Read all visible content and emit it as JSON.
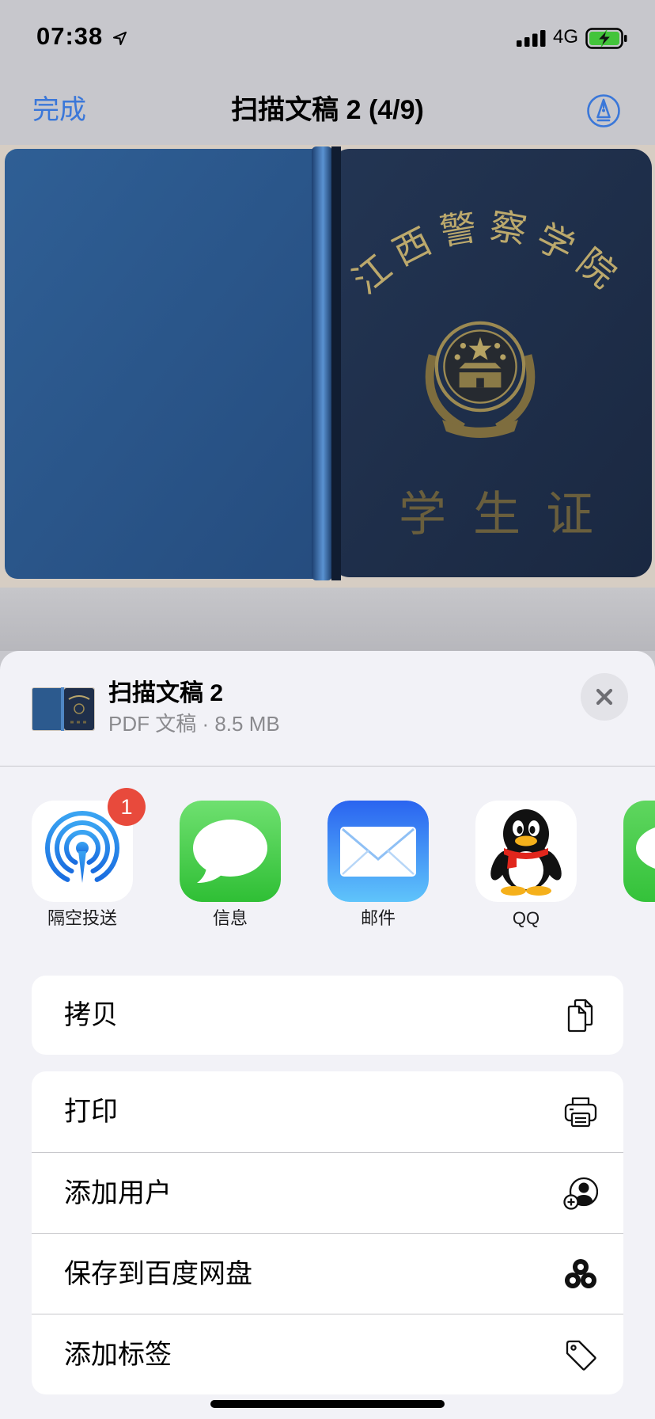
{
  "status_bar": {
    "time": "07:38",
    "network": "4G",
    "icons": [
      "location-arrow-icon",
      "cellular-signal-icon",
      "battery-charging-icon"
    ]
  },
  "nav": {
    "done_label": "完成",
    "title": "扫描文稿 2 (4/9)",
    "markup_icon": "markup-pen-icon"
  },
  "document_photo": {
    "school_name": "江西警察学院",
    "card_title": "学生证",
    "emblem": "national-emblem-icon"
  },
  "share_sheet": {
    "file_name": "扫描文稿 2",
    "file_meta": "PDF 文稿 · 8.5 MB",
    "close_icon": "close-icon",
    "apps": [
      {
        "label": "隔空投送",
        "icon": "airdrop-icon",
        "badge": "1"
      },
      {
        "label": "信息",
        "icon": "messages-icon"
      },
      {
        "label": "邮件",
        "icon": "mail-icon"
      },
      {
        "label": "QQ",
        "icon": "qq-penguin-icon"
      }
    ],
    "partial_app_icon": "chat-bubble-app-icon",
    "copy_group": [
      {
        "label": "拷贝",
        "icon": "copy-icon"
      }
    ],
    "actions": [
      {
        "label": "打印",
        "icon": "printer-icon"
      },
      {
        "label": "添加用户",
        "icon": "add-person-icon"
      },
      {
        "label": "保存到百度网盘",
        "icon": "baidu-netdisk-icon"
      },
      {
        "label": "添加标签",
        "icon": "tag-icon"
      }
    ]
  },
  "colors": {
    "accent": "#3a77d9",
    "badge": "#e84a3c",
    "sheet_background": "#f2f2f7",
    "card_background": "#ffffff",
    "battery_fill": "#43c43b",
    "cover_light": "#2c5a8e",
    "cover_dark": "#1f2f4b",
    "gold": "#b9a56a"
  }
}
